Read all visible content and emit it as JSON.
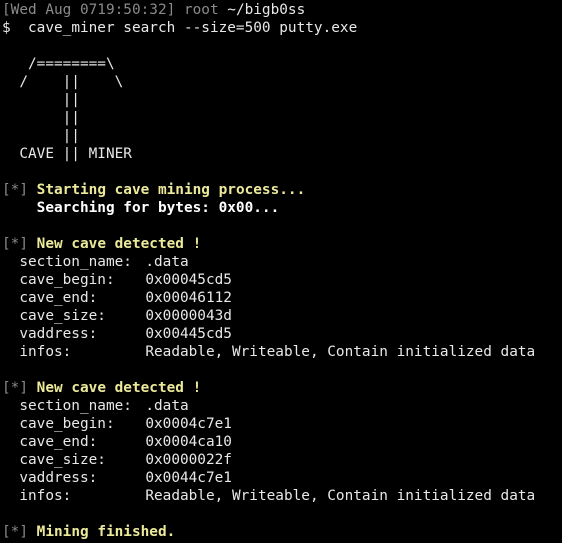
{
  "prompt": {
    "timestamp": "[Wed Aug 0719:50:32]",
    "user": "root",
    "path": "~/bigb0ss",
    "symbol": "$",
    "command": "cave_miner search --size=500 putty.exe"
  },
  "banner": [
    "   /========\\",
    "  /    ||    \\",
    "       ||",
    "       ||",
    "       ||",
    "  CAVE || MINER"
  ],
  "status_prefix": "[*]",
  "start": {
    "message": "Starting cave mining process...",
    "searching": "Searching for bytes: 0x00..."
  },
  "caves": [
    {
      "header": "New cave detected !",
      "fields": [
        {
          "key": "section_name:",
          "value": ".data"
        },
        {
          "key": "cave_begin:",
          "value": "0x00045cd5"
        },
        {
          "key": "cave_end:",
          "value": "0x00046112"
        },
        {
          "key": "cave_size:",
          "value": "0x0000043d"
        },
        {
          "key": "vaddress:",
          "value": "0x00445cd5"
        },
        {
          "key": "infos:",
          "value": "Readable, Writeable, Contain initialized data"
        }
      ]
    },
    {
      "header": "New cave detected !",
      "fields": [
        {
          "key": "section_name:",
          "value": ".data"
        },
        {
          "key": "cave_begin:",
          "value": "0x0004c7e1"
        },
        {
          "key": "cave_end:",
          "value": "0x0004ca10"
        },
        {
          "key": "cave_size:",
          "value": "0x0000022f"
        },
        {
          "key": "vaddress:",
          "value": "0x0044c7e1"
        },
        {
          "key": "infos:",
          "value": "Readable, Writeable, Contain initialized data"
        }
      ]
    }
  ],
  "finish": {
    "message": "Mining finished."
  },
  "colors": {
    "background": "#000000",
    "text": "#e8e8e8",
    "dim": "#8a8a8a",
    "highlight": "#ecea9a"
  }
}
